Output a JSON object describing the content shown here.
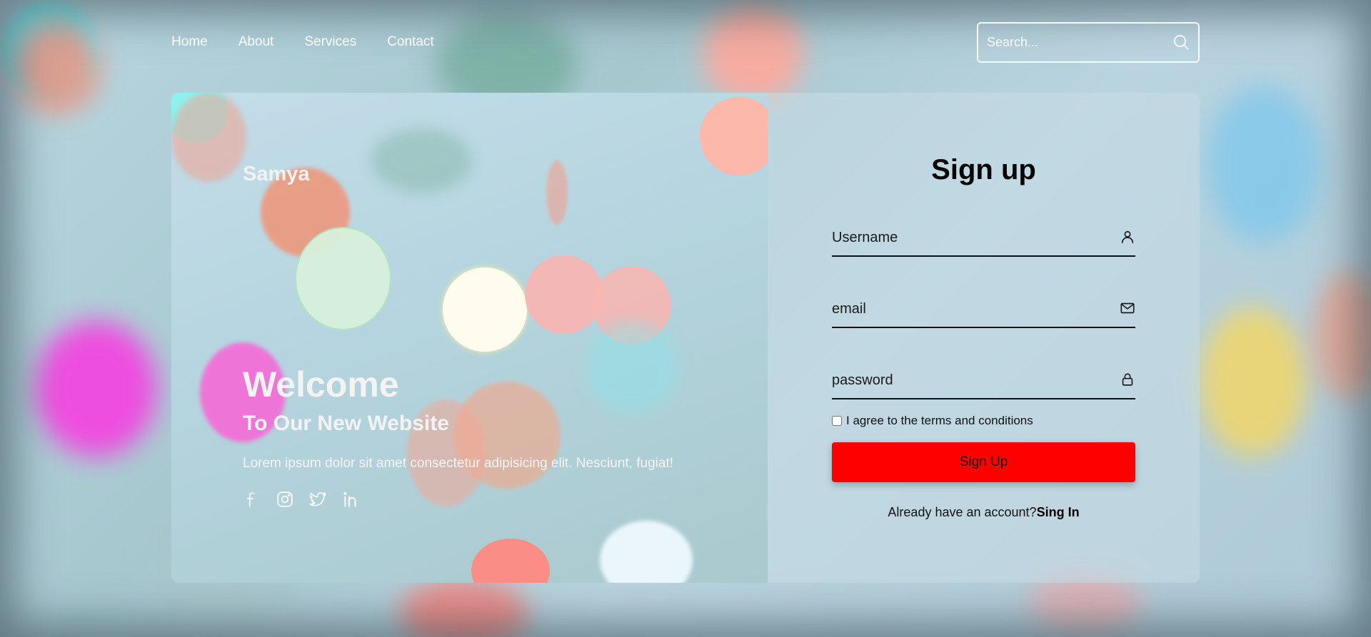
{
  "nav": {
    "links": [
      "Home",
      "About",
      "Services",
      "Contact"
    ]
  },
  "search": {
    "placeholder": "Search...",
    "icon": "search-icon"
  },
  "hero": {
    "brand": "Samya",
    "welcome": "Welcome",
    "subtitle": "To Our New Website",
    "text": "Lorem ipsum dolor sit amet consectetur adipisicing elit. Nesciunt, fugiat!",
    "social_icons": [
      "facebook-icon",
      "instagram-icon",
      "twitter-icon",
      "linkedin-icon"
    ]
  },
  "form": {
    "title": "Sign up",
    "username_placeholder": "Username",
    "email_placeholder": "email",
    "password_placeholder": "password",
    "terms_label": "I agree to the terms and conditions",
    "submit_label": "Sign Up",
    "already_text": "Already have an account?",
    "signin_link": "Sing In"
  },
  "colors": {
    "button": "#ff0000",
    "text_light": "#ffffff",
    "text_dark": "#111111"
  }
}
